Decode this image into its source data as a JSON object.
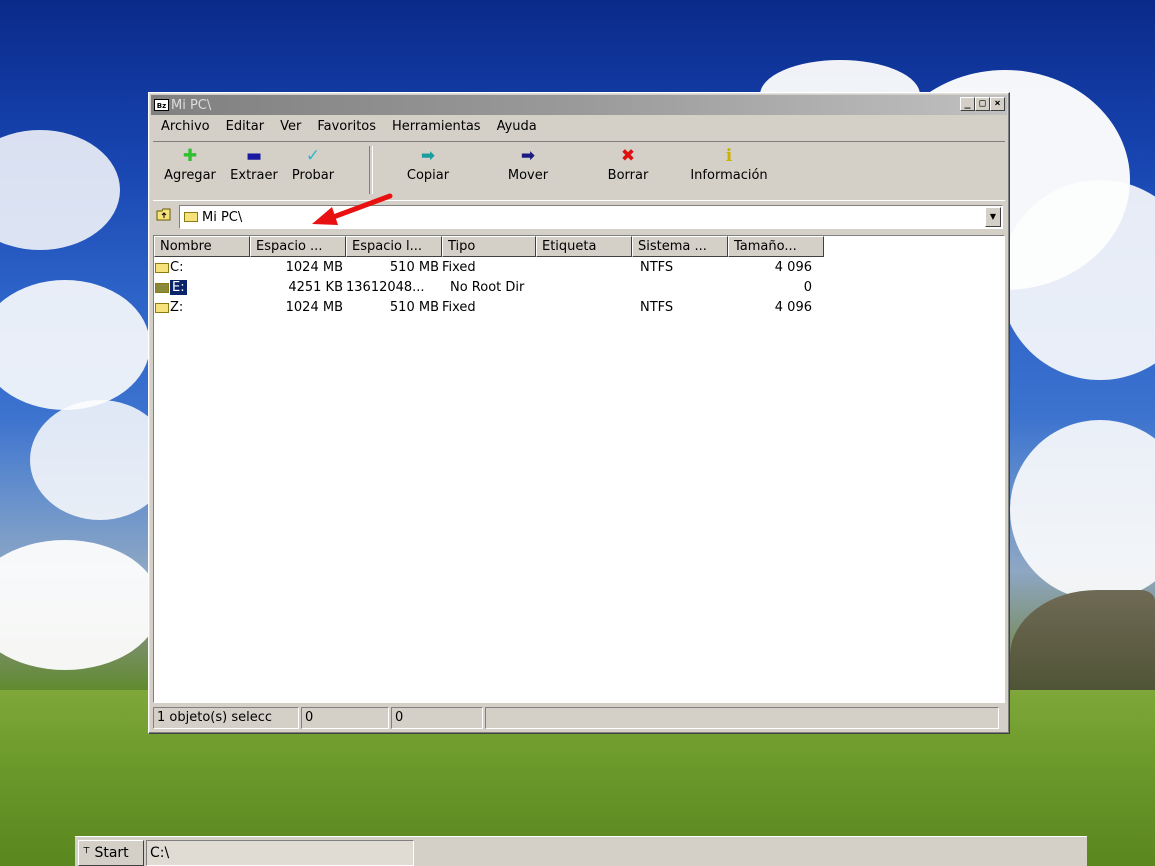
{
  "window": {
    "title": "Mi PC\\",
    "icon_text": "Bz",
    "controls": [
      "_",
      "□",
      "×"
    ]
  },
  "menu": [
    "Archivo",
    "Editar",
    "Ver",
    "Favoritos",
    "Herramientas",
    "Ayuda"
  ],
  "toolbar": {
    "add": {
      "label": "Agregar",
      "icon": "plus-icon",
      "glyph": "✚",
      "color": "#2fbf2f"
    },
    "extract": {
      "label": "Extraer",
      "icon": "minus-icon",
      "glyph": "▬",
      "color": "#1a1aa0"
    },
    "test": {
      "label": "Probar",
      "icon": "check-icon",
      "glyph": "✓",
      "color": "#2ab8c8"
    },
    "copy": {
      "label": "Copiar",
      "icon": "copy-arrow-icon",
      "glyph": "➡",
      "color": "#1c9e9e"
    },
    "move": {
      "label": "Mover",
      "icon": "move-arrow-icon",
      "glyph": "➡",
      "color": "#1a1a80"
    },
    "delete": {
      "label": "Borrar",
      "icon": "delete-x-icon",
      "glyph": "✖",
      "color": "#e01010"
    },
    "info": {
      "label": "Información",
      "icon": "info-icon",
      "glyph": "i",
      "color": "#c8b400"
    }
  },
  "address": {
    "path": "Mi PC\\"
  },
  "columns": [
    "Nombre",
    "Espacio ...",
    "Espacio l...",
    "Tipo",
    "Etiqueta",
    "Sistema ...",
    "Tamaño..."
  ],
  "rows": [
    {
      "name": "C:",
      "total": "1024 MB",
      "free": "510 MB",
      "type": "Fixed",
      "label": "",
      "fs": "NTFS",
      "size": "4 096",
      "selected": false
    },
    {
      "name": "E:",
      "total": "4251 KB",
      "free": "13612048...",
      "type": "No Root Dir",
      "label": "",
      "fs": "",
      "size": "0",
      "selected": true
    },
    {
      "name": "Z:",
      "total": "1024 MB",
      "free": "510 MB",
      "type": "Fixed",
      "label": "",
      "fs": "NTFS",
      "size": "4 096",
      "selected": false
    }
  ],
  "status": {
    "selected": "1 objeto(s) selecc",
    "size1": "0",
    "size2": "0",
    "extra": ""
  },
  "taskbar": {
    "start": "Start",
    "task": "C:\\"
  }
}
